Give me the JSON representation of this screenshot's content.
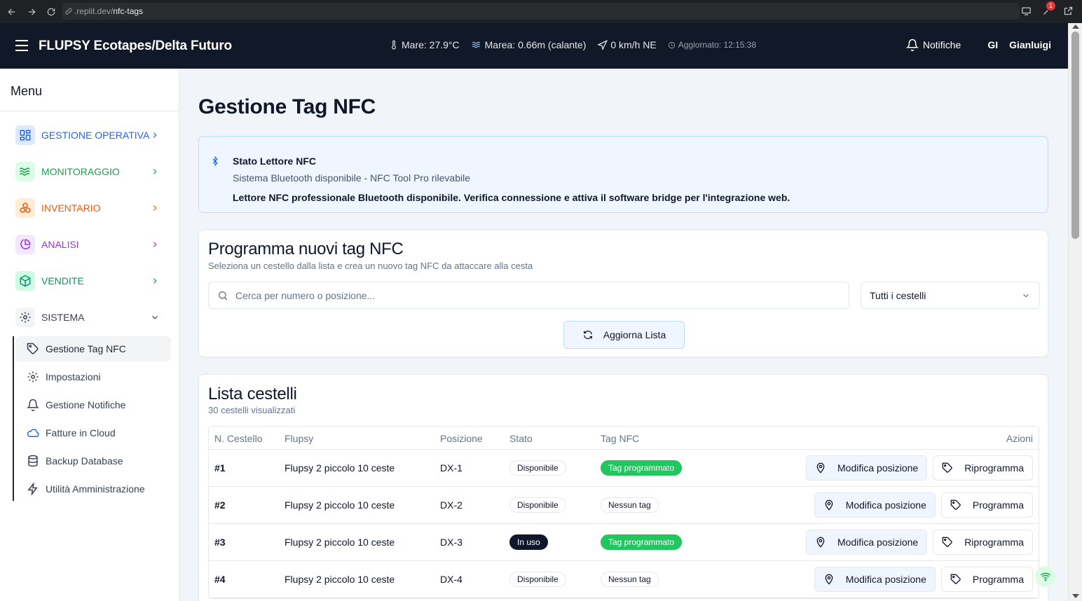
{
  "browser": {
    "url_host": ".replit.dev/",
    "url_path": "nfc-tags",
    "ext_badge": "1"
  },
  "header": {
    "title": "FLUPSY Ecotapes/Delta Futuro",
    "sea_temp": "Mare: 27.9°C",
    "tide": "Marea: 0.66m (calante)",
    "wind": "0 km/h NE",
    "updated": "Aggiornato: 12:15:38",
    "notifications_label": "Notifiche",
    "user_initials": "GI",
    "user_name": "Gianluigi"
  },
  "sidebar": {
    "title": "Menu",
    "groups": [
      {
        "label": "GESTIONE OPERATIVA",
        "color": "#2563eb",
        "bg": "#dbeafe",
        "icon": "grid-icon"
      },
      {
        "label": "MONITORAGGIO",
        "color": "#16a34a",
        "bg": "#dcfce7",
        "icon": "waves-icon"
      },
      {
        "label": "INVENTARIO",
        "color": "#ea580c",
        "bg": "#ffedd5",
        "icon": "boxes-icon"
      },
      {
        "label": "ANALISI",
        "color": "#9333ea",
        "bg": "#f3e8ff",
        "icon": "pie-chart-icon"
      },
      {
        "label": "VENDITE",
        "color": "#059669",
        "bg": "#d1fae5",
        "icon": "package-icon"
      },
      {
        "label": "SISTEMA",
        "color": "#374151",
        "bg": "#f3f4f6",
        "icon": "gear-icon"
      }
    ],
    "sub_items": [
      {
        "label": "Gestione Tag NFC",
        "icon": "tag-icon"
      },
      {
        "label": "Impostazioni",
        "icon": "gear-icon"
      },
      {
        "label": "Gestione Notifiche",
        "icon": "bell-icon"
      },
      {
        "label": "Fatture in Cloud",
        "icon": "cloud-icon"
      },
      {
        "label": "Backup Database",
        "icon": "database-icon"
      },
      {
        "label": "Utilità Amministrazione",
        "icon": "zap-icon"
      }
    ]
  },
  "main": {
    "page_title": "Gestione Tag NFC",
    "reader": {
      "title": "Stato Lettore NFC",
      "subtitle": "Sistema Bluetooth disponibile - NFC Tool Pro rilevabile",
      "message": "Lettore NFC professionale Bluetooth disponibile. Verifica connessione e attiva il software bridge per l'integrazione web."
    },
    "program": {
      "title": "Programma nuovi tag NFC",
      "subtitle": "Seleziona un cestello dalla lista e crea un nuovo tag NFC da attaccare alla cesta",
      "search_placeholder": "Cerca per numero o posizione...",
      "filter_value": "Tutti i cestelli",
      "refresh_label": "Aggiorna Lista"
    },
    "list": {
      "title": "Lista cestelli",
      "subtitle": "30 cestelli visualizzati",
      "columns": [
        "N. Cestello",
        "Flupsy",
        "Posizione",
        "Stato",
        "Tag NFC",
        "Azioni"
      ],
      "modify_label": "Modifica posizione",
      "rows": [
        {
          "num": "#1",
          "flupsy": "Flupsy 2 piccolo 10 ceste",
          "pos": "DX-1",
          "state": "Disponibile",
          "state_style": "outline",
          "tag": "Tag programmato",
          "tag_style": "green",
          "action": "Riprogramma"
        },
        {
          "num": "#2",
          "flupsy": "Flupsy 2 piccolo 10 ceste",
          "pos": "DX-2",
          "state": "Disponibile",
          "state_style": "outline",
          "tag": "Nessun tag",
          "tag_style": "outline",
          "action": "Programma"
        },
        {
          "num": "#3",
          "flupsy": "Flupsy 2 piccolo 10 ceste",
          "pos": "DX-3",
          "state": "In uso",
          "state_style": "dark",
          "tag": "Tag programmato",
          "tag_style": "green",
          "action": "Riprogramma"
        },
        {
          "num": "#4",
          "flupsy": "Flupsy 2 piccolo 10 ceste",
          "pos": "DX-4",
          "state": "Disponibile",
          "state_style": "outline",
          "tag": "Nessun tag",
          "tag_style": "outline",
          "action": "Programma"
        }
      ]
    }
  }
}
